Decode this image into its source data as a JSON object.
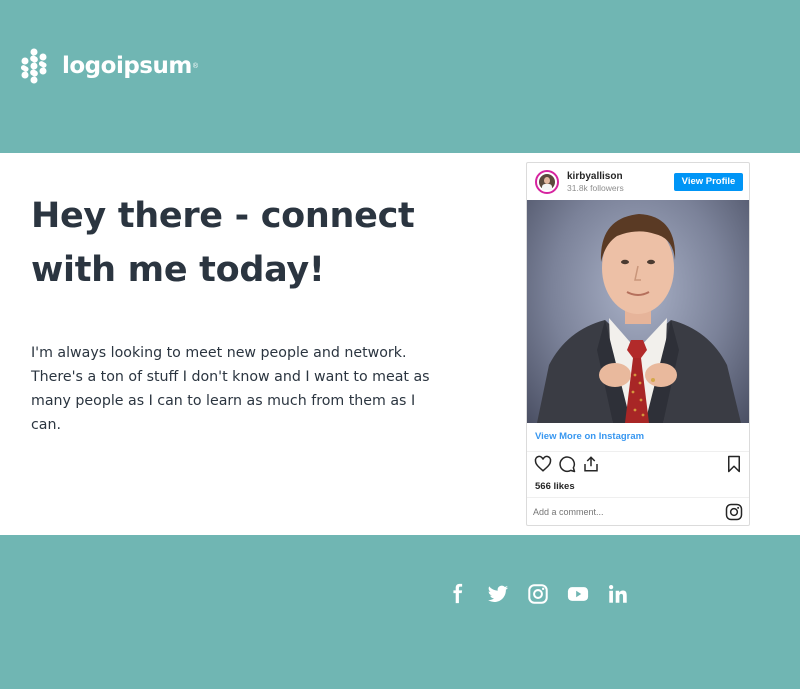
{
  "brand": {
    "logo_text": "logoipsum",
    "logo_mark": "®",
    "header_color": "#70b6b3"
  },
  "main": {
    "headline_line1": "Hey there - connect",
    "headline_line2": "with me today!",
    "intro": "I'm always looking to meet new people and network. There's a ton of stuff I don't know and I want to meat as many people as I can to learn as much from them as I can."
  },
  "instagram": {
    "username": "kirbyallison",
    "followers": "31.8k followers",
    "view_profile_label": "View Profile",
    "view_more_label": "View More on Instagram",
    "likes": "566 likes",
    "comment_placeholder": "Add a comment...",
    "accent": "#0095f6",
    "icons": [
      "heart-icon",
      "comment-icon",
      "share-icon",
      "bookmark-icon",
      "instagram-glyph-icon"
    ]
  },
  "footer": {
    "social_icons": [
      "facebook-icon",
      "twitter-icon",
      "instagram-icon",
      "youtube-icon",
      "linkedin-icon"
    ],
    "footer_color": "#70b6b3"
  }
}
